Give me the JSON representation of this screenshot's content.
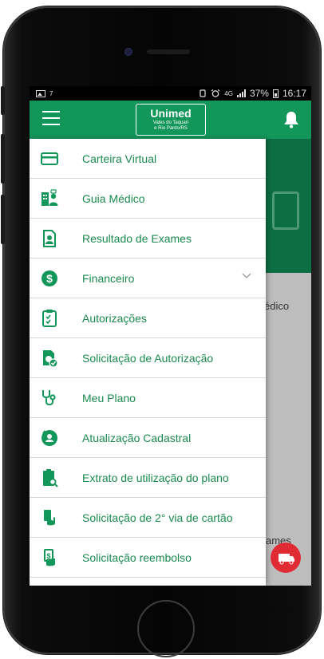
{
  "statusbar": {
    "left_text": "7",
    "network": "4G",
    "battery": "37%",
    "time": "16:17"
  },
  "appbar": {
    "logo_main": "Unimed",
    "logo_sub_1": "Vales do Taquari",
    "logo_sub_2": "e Rio Pardo/RS",
    "colors": {
      "primary": "#13965a",
      "accent": "#e02b35"
    }
  },
  "background": {
    "partial_1": "édico",
    "partial_2": "ames"
  },
  "menu": {
    "items": [
      {
        "label": "Carteira Virtual",
        "icon": "card-icon"
      },
      {
        "label": "Guia Médico",
        "icon": "doctors-icon"
      },
      {
        "label": "Resultado de Exames",
        "icon": "exam-results-icon"
      },
      {
        "label": "Financeiro",
        "icon": "dollar-icon",
        "expandable": true
      },
      {
        "label": "Autorizações",
        "icon": "clipboard-check-icon"
      },
      {
        "label": "Solicitação de Autorização",
        "icon": "request-authorization-icon"
      },
      {
        "label": "Meu Plano",
        "icon": "stethoscope-icon"
      },
      {
        "label": "Atualização Cadastral",
        "icon": "profile-update-icon"
      },
      {
        "label": "Extrato de utilização do plano",
        "icon": "usage-statement-icon"
      },
      {
        "label": "Solicitação de 2° via de cartão",
        "icon": "card-copy-icon"
      },
      {
        "label": "Solicitação reembolso",
        "icon": "refund-icon"
      }
    ]
  }
}
